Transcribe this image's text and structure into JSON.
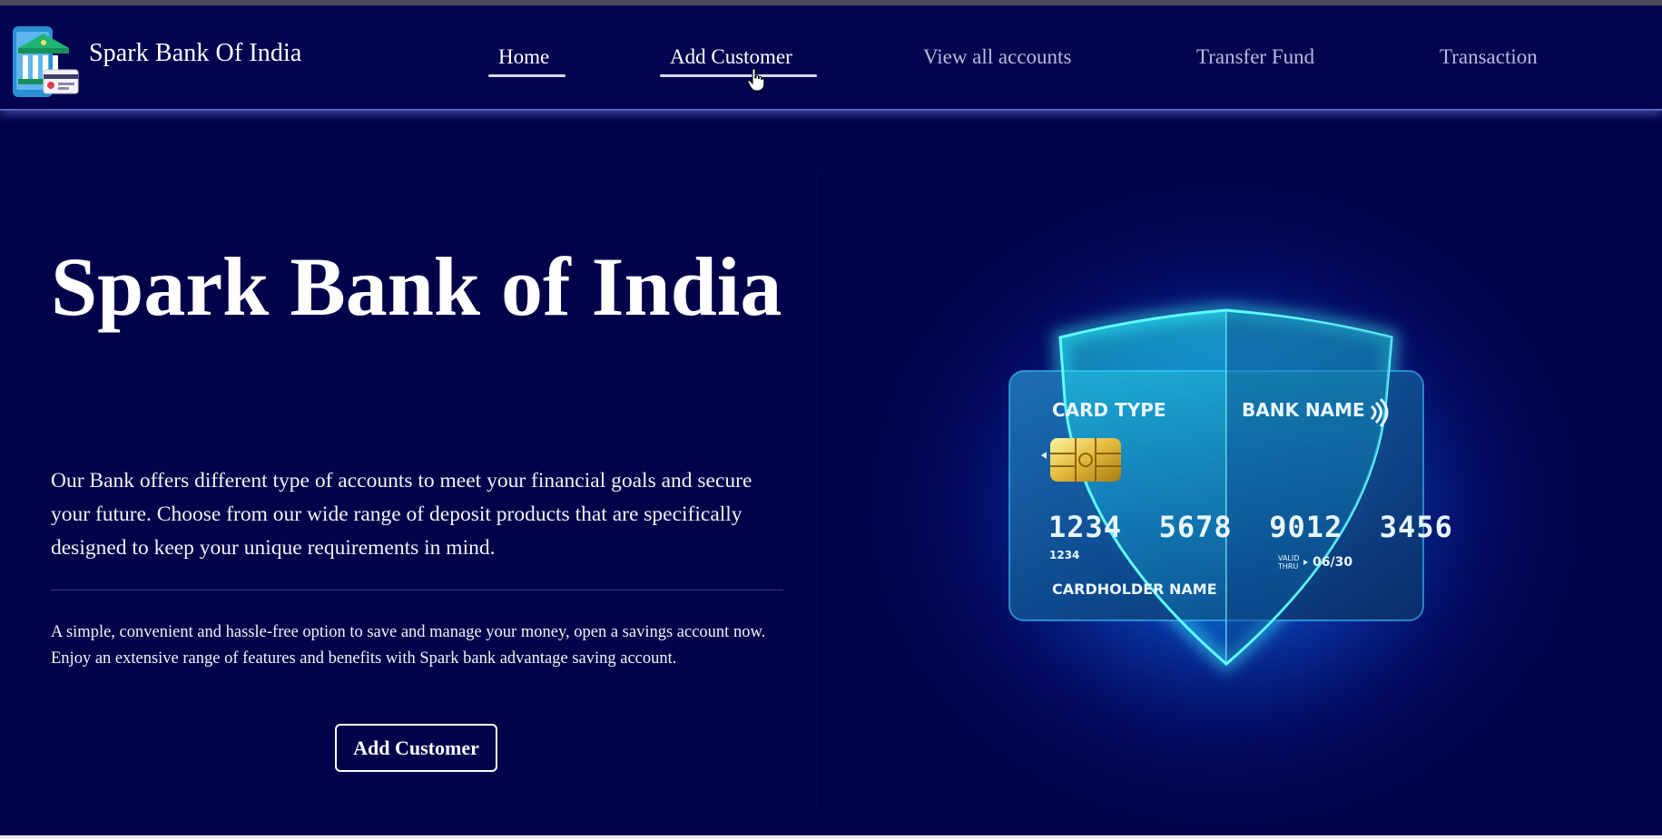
{
  "brand": {
    "name": "Spark Bank Of India",
    "logo_icon": "bank-building-icon"
  },
  "nav": {
    "items": [
      {
        "label": "Home",
        "active": true
      },
      {
        "label": "Add Customer",
        "hover": true
      },
      {
        "label": "View all accounts"
      },
      {
        "label": "Transfer Fund"
      },
      {
        "label": "Transaction"
      }
    ]
  },
  "hero": {
    "title": "Spark Bank of India",
    "paragraph1": "Our Bank offers different type of accounts to meet your financial goals and secure your future. Choose from our wide range of deposit products that are specifically designed to keep your unique requirements in mind.",
    "paragraph2": "A simple, convenient and hassle-free option to save and manage your money, open a savings account now. Enjoy an extensive range of features and benefits with Spark bank advantage saving account.",
    "button_label": "Add Customer"
  },
  "card": {
    "card_type": "CARD TYPE",
    "bank_name": "BANK NAME",
    "number": "1234  5678  9012  3456",
    "small_number": "1234",
    "valid_label_1": "VALID",
    "valid_label_2": "THRU",
    "expiry": "06/30",
    "holder": "CARDHOLDER NAME"
  },
  "colors": {
    "background": "#02024a",
    "navbar": "#030350",
    "accent_cyan": "#19f0f0",
    "text": "#ffffff",
    "nav_inactive": "#b9bbd9"
  }
}
